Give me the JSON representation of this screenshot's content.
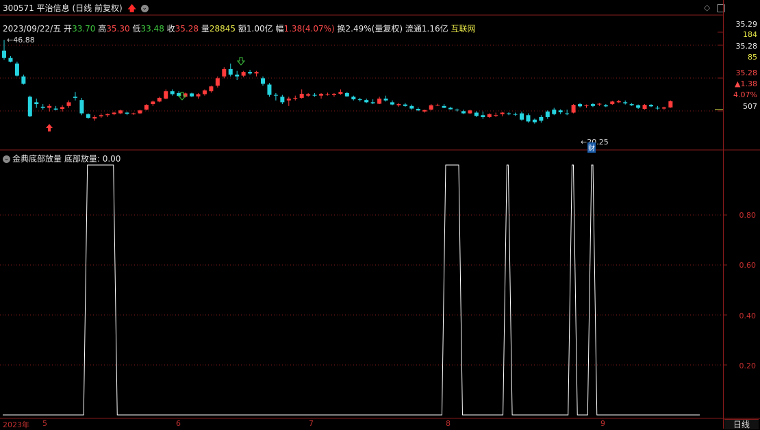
{
  "header": {
    "code": "300571",
    "name": "平治信息",
    "mode": "(日线 前复权)",
    "arrow": "🡅",
    "circle": "⌄"
  },
  "quote": {
    "date": "2023/09/22/五",
    "open_label": "开",
    "open": "33.70",
    "high_label": "高",
    "high": "35.30",
    "low_label": "低",
    "low": "33.48",
    "close_label": "收",
    "close": "35.28",
    "vol_label": "量",
    "vol": "28845",
    "amount_label": "额",
    "amount": "1.00亿",
    "chg_label": "幅",
    "chg": "1.38(4.07%)",
    "turnover_label": "换",
    "turnover": "2.49%(量复权)",
    "float_label": "流通",
    "float": "1.16亿",
    "sector": "互联网"
  },
  "annotations": {
    "high_mark": "46.88",
    "low_mark": "20.25",
    "cai_badge": "财"
  },
  "right_axis_top": {
    "price": "35.29",
    "vol": "184",
    "price2": "35.28",
    "vol2": "85",
    "price3": "35.28",
    "chg": "▲1.38",
    "pct": "4.07%",
    "v507": "507"
  },
  "indicator": {
    "name": "金典底部放量",
    "line_label": "底部放量:",
    "value": "0.00",
    "ticks": [
      "0.80",
      "0.60",
      "0.40",
      "0.20"
    ]
  },
  "bottom_axis": {
    "year": "2023年",
    "months": [
      "5",
      "6",
      "7",
      "8",
      "9"
    ],
    "period_tab": "日线"
  },
  "colors": {
    "up": "#ff3b3b",
    "down": "#26d4e0",
    "grid": "#8a1b1b",
    "indicator": "#ffffff"
  },
  "chart_data": {
    "type": "candlestick+indicator",
    "candles_note": "daily OHLC approximated from screen",
    "candles": [
      [
        44.0,
        46.9,
        41.5,
        42.0
      ],
      [
        42.0,
        42.5,
        40.8,
        41.0
      ],
      [
        40.5,
        41.0,
        37.0,
        37.2
      ],
      [
        37.0,
        37.5,
        34.8,
        35.0
      ],
      [
        31.5,
        31.8,
        26.0,
        26.2
      ],
      [
        30.0,
        31.0,
        28.5,
        29.5
      ],
      [
        28.8,
        29.5,
        28.0,
        28.5
      ],
      [
        28.5,
        29.5,
        27.5,
        29.0
      ],
      [
        28.3,
        29.0,
        27.8,
        28.0
      ],
      [
        28.2,
        29.2,
        27.5,
        28.7
      ],
      [
        29.0,
        30.5,
        28.5,
        30.0
      ],
      [
        31.5,
        32.8,
        30.5,
        31.2
      ],
      [
        30.6,
        31.2,
        26.5,
        27.0
      ],
      [
        26.8,
        27.0,
        25.5,
        25.8
      ],
      [
        25.6,
        26.5,
        25.0,
        26.0
      ],
      [
        26.2,
        27.0,
        25.8,
        26.5
      ],
      [
        26.5,
        27.0,
        26.0,
        26.8
      ],
      [
        26.8,
        27.5,
        26.5,
        27.2
      ],
      [
        27.0,
        28.0,
        26.8,
        27.8
      ],
      [
        27.2,
        27.5,
        26.5,
        26.9
      ],
      [
        26.8,
        27.2,
        26.6,
        27.0
      ],
      [
        27.0,
        28.0,
        26.8,
        27.8
      ],
      [
        28.0,
        29.5,
        27.8,
        29.3
      ],
      [
        29.5,
        30.5,
        29.0,
        30.2
      ],
      [
        30.2,
        31.5,
        30.0,
        31.2
      ],
      [
        31.0,
        33.5,
        30.8,
        33.0
      ],
      [
        33.0,
        33.5,
        31.8,
        32.2
      ],
      [
        32.5,
        33.0,
        31.5,
        31.7
      ],
      [
        31.5,
        32.6,
        31.3,
        32.4
      ],
      [
        32.4,
        32.6,
        31.4,
        31.6
      ],
      [
        31.6,
        32.5,
        31.0,
        32.2
      ],
      [
        32.2,
        33.5,
        31.8,
        33.2
      ],
      [
        33.0,
        34.5,
        32.6,
        34.3
      ],
      [
        34.5,
        37.0,
        34.0,
        36.5
      ],
      [
        37.0,
        39.5,
        36.5,
        39.0
      ],
      [
        39.0,
        40.5,
        37.0,
        37.5
      ],
      [
        37.5,
        38.5,
        36.0,
        37.0
      ],
      [
        37.2,
        38.5,
        36.8,
        38.2
      ],
      [
        38.2,
        38.8,
        37.5,
        37.8
      ],
      [
        37.8,
        38.5,
        37.0,
        38.2
      ],
      [
        36.5,
        37.0,
        34.5,
        35.0
      ],
      [
        34.8,
        35.2,
        31.5,
        32.0
      ],
      [
        32.0,
        32.5,
        30.5,
        31.8
      ],
      [
        31.5,
        32.0,
        29.5,
        30.0
      ],
      [
        30.5,
        31.5,
        29.0,
        31.0
      ],
      [
        31.0,
        31.8,
        30.5,
        31.2
      ],
      [
        31.2,
        33.5,
        31.0,
        32.3
      ],
      [
        31.8,
        32.5,
        31.5,
        32.2
      ],
      [
        32.0,
        32.5,
        31.5,
        31.8
      ],
      [
        31.8,
        32.5,
        31.0,
        32.3
      ],
      [
        32.0,
        32.6,
        31.8,
        32.1
      ],
      [
        32.0,
        32.5,
        31.5,
        32.3
      ],
      [
        32.3,
        33.5,
        32.0,
        32.8
      ],
      [
        32.5,
        32.8,
        31.5,
        31.6
      ],
      [
        31.5,
        31.8,
        30.5,
        30.8
      ],
      [
        30.8,
        31.2,
        30.2,
        30.6
      ],
      [
        30.6,
        31.0,
        29.8,
        30.0
      ],
      [
        30.0,
        30.8,
        29.5,
        29.7
      ],
      [
        29.6,
        31.5,
        29.5,
        31.0
      ],
      [
        31.0,
        31.8,
        30.2,
        30.5
      ],
      [
        30.0,
        30.5,
        29.2,
        29.4
      ],
      [
        29.2,
        29.8,
        28.8,
        29.5
      ],
      [
        29.4,
        29.8,
        28.8,
        29.0
      ],
      [
        29.0,
        29.4,
        28.0,
        28.3
      ],
      [
        28.2,
        28.6,
        27.6,
        27.8
      ],
      [
        27.5,
        28.0,
        27.2,
        27.9
      ],
      [
        28.0,
        29.5,
        27.8,
        29.2
      ],
      [
        29.3,
        29.6,
        29.0,
        29.3
      ],
      [
        29.0,
        29.5,
        28.4,
        28.5
      ],
      [
        28.5,
        28.8,
        28.0,
        28.1
      ],
      [
        28.0,
        28.3,
        27.5,
        27.8
      ],
      [
        27.6,
        28.0,
        26.8,
        27.0
      ],
      [
        27.0,
        28.0,
        26.8,
        27.8
      ],
      [
        27.2,
        27.6,
        26.0,
        26.3
      ],
      [
        26.5,
        27.5,
        25.5,
        26.0
      ],
      [
        26.0,
        27.0,
        25.8,
        26.8
      ],
      [
        26.5,
        27.2,
        26.0,
        26.5
      ],
      [
        26.8,
        27.4,
        26.2,
        27.2
      ],
      [
        27.0,
        27.3,
        26.5,
        26.8
      ],
      [
        26.8,
        27.2,
        26.3,
        26.7
      ],
      [
        27.0,
        27.5,
        25.0,
        25.3
      ],
      [
        26.5,
        27.0,
        24.5,
        24.8
      ],
      [
        25.3,
        25.6,
        24.2,
        24.6
      ],
      [
        26.0,
        26.5,
        24.5,
        25.0
      ],
      [
        27.5,
        27.8,
        25.5,
        26.0
      ],
      [
        28.0,
        28.5,
        26.5,
        26.8
      ],
      [
        27.8,
        28.1,
        26.8,
        27.3
      ],
      [
        27.0,
        28.0,
        26.5,
        26.9
      ],
      [
        27.2,
        29.5,
        27.0,
        29.3
      ],
      [
        29.5,
        29.8,
        28.6,
        28.9
      ],
      [
        29.0,
        29.4,
        28.5,
        29.2
      ],
      [
        29.5,
        29.8,
        28.7,
        29.0
      ],
      [
        29.4,
        29.8,
        29.0,
        29.6
      ],
      [
        29.2,
        29.5,
        28.7,
        28.9
      ],
      [
        29.5,
        30.4,
        29.3,
        30.2
      ],
      [
        30.0,
        30.6,
        29.8,
        30.3
      ],
      [
        30.0,
        30.5,
        29.4,
        29.7
      ],
      [
        29.5,
        29.8,
        29.0,
        29.2
      ],
      [
        29.2,
        29.4,
        28.2,
        28.5
      ],
      [
        28.2,
        29.5,
        28.0,
        29.3
      ],
      [
        29.3,
        29.5,
        28.7,
        28.9
      ],
      [
        28.5,
        29.0,
        28.0,
        28.4
      ],
      [
        28.3,
        28.8,
        28.0,
        28.6
      ],
      [
        28.6,
        30.5,
        28.5,
        30.3
      ]
    ],
    "indicator_series": {
      "name": "底部放量",
      "ylim": [
        0,
        1
      ],
      "pulses": [
        [
          13,
          17
        ],
        [
          68,
          70
        ],
        [
          77,
          78
        ],
        [
          87,
          88
        ],
        [
          90,
          91
        ]
      ],
      "total_bars": 108
    }
  }
}
